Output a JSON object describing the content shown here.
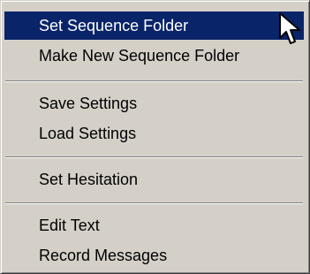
{
  "menu": {
    "items": [
      {
        "label": "Set Sequence Folder",
        "highlighted": true
      },
      {
        "label": "Make New Sequence Folder"
      },
      {
        "label": "Save Settings"
      },
      {
        "label": "Load Settings"
      },
      {
        "label": "Set Hesitation"
      },
      {
        "label": "Edit Text"
      },
      {
        "label": "Record Messages"
      }
    ]
  },
  "colors": {
    "menu_background": "#d4d0c8",
    "highlight": "#0a246a",
    "highlight_text": "#ffffff"
  },
  "cursor": {
    "icon": "arrow-pointer-icon"
  }
}
